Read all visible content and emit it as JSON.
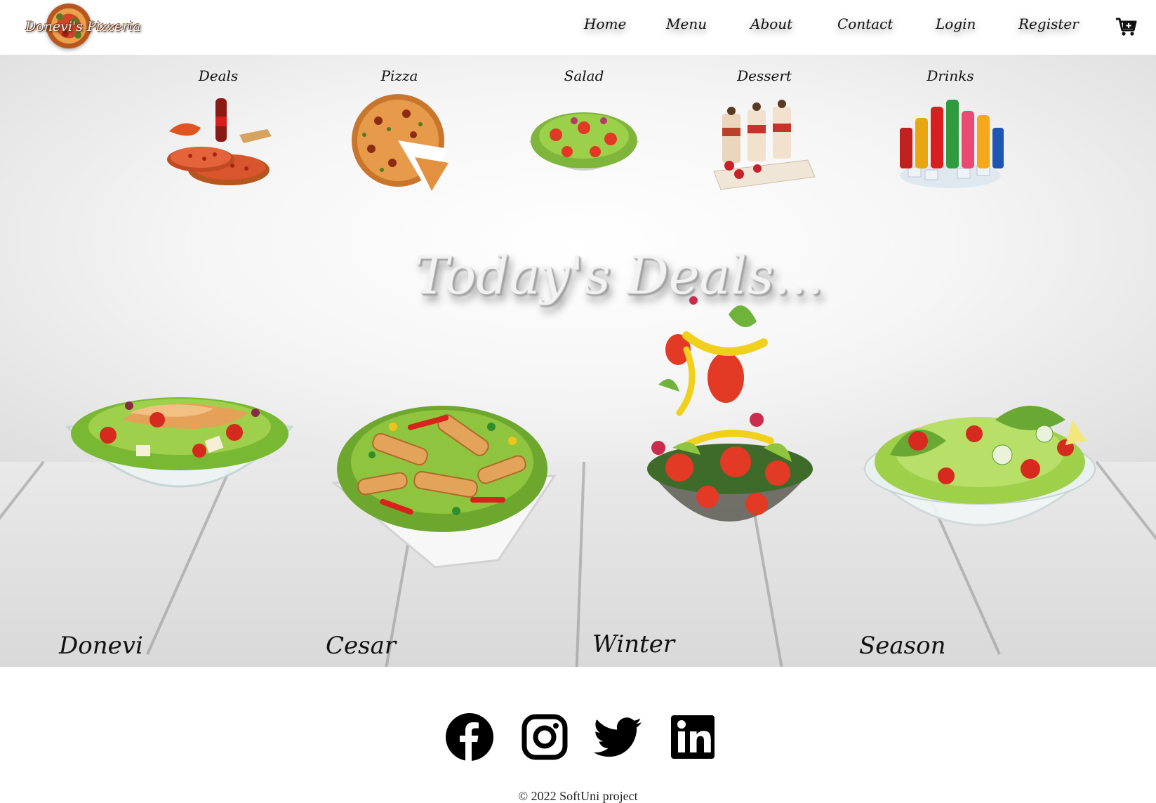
{
  "brand": {
    "logo_text": "Donevi's Pizzeria"
  },
  "nav": {
    "links": [
      "Home",
      "Menu",
      "About",
      "Contact",
      "Login",
      "Register"
    ],
    "cart_icon": "cart-plus-icon"
  },
  "categories": [
    {
      "label": "Deals",
      "icon": "deals-combo-image"
    },
    {
      "label": "Pizza",
      "icon": "pizza-image"
    },
    {
      "label": "Salad",
      "icon": "salad-image"
    },
    {
      "label": "Dessert",
      "icon": "dessert-image"
    },
    {
      "label": "Drinks",
      "icon": "drinks-image"
    }
  ],
  "hero": {
    "title": "Today's Deals..."
  },
  "deals": [
    {
      "name": "Donevi"
    },
    {
      "name": "Cesar"
    },
    {
      "name": "Winter"
    },
    {
      "name": "Season"
    }
  ],
  "footer": {
    "social": [
      "facebook-icon",
      "instagram-icon",
      "twitter-icon",
      "linkedin-icon"
    ],
    "copyright": "© 2022 SoftUni project"
  },
  "colors": {
    "header_bg": "#ffffff",
    "text": "#111111",
    "hero_wall": "#f4f4f4",
    "floor": "#d9d9d9"
  }
}
